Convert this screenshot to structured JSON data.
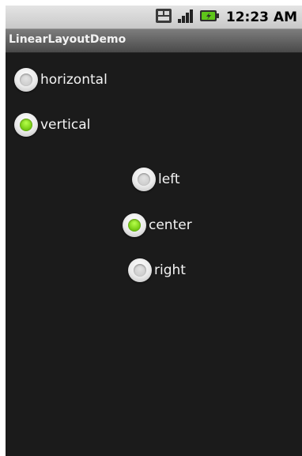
{
  "statusbar": {
    "time": "12:23 AM",
    "icons": [
      "usb-debug-icon",
      "signal-icon",
      "battery-charging-icon"
    ]
  },
  "app": {
    "title": "LinearLayoutDemo"
  },
  "orientation_group": {
    "options": [
      {
        "label": "horizontal",
        "checked": false
      },
      {
        "label": "vertical",
        "checked": true
      }
    ]
  },
  "gravity_group": {
    "options": [
      {
        "label": "left",
        "checked": false
      },
      {
        "label": "center",
        "checked": true
      },
      {
        "label": "right",
        "checked": false
      }
    ]
  },
  "colors": {
    "checked_dot": "#7fd21a",
    "background": "#1b1b1b"
  }
}
